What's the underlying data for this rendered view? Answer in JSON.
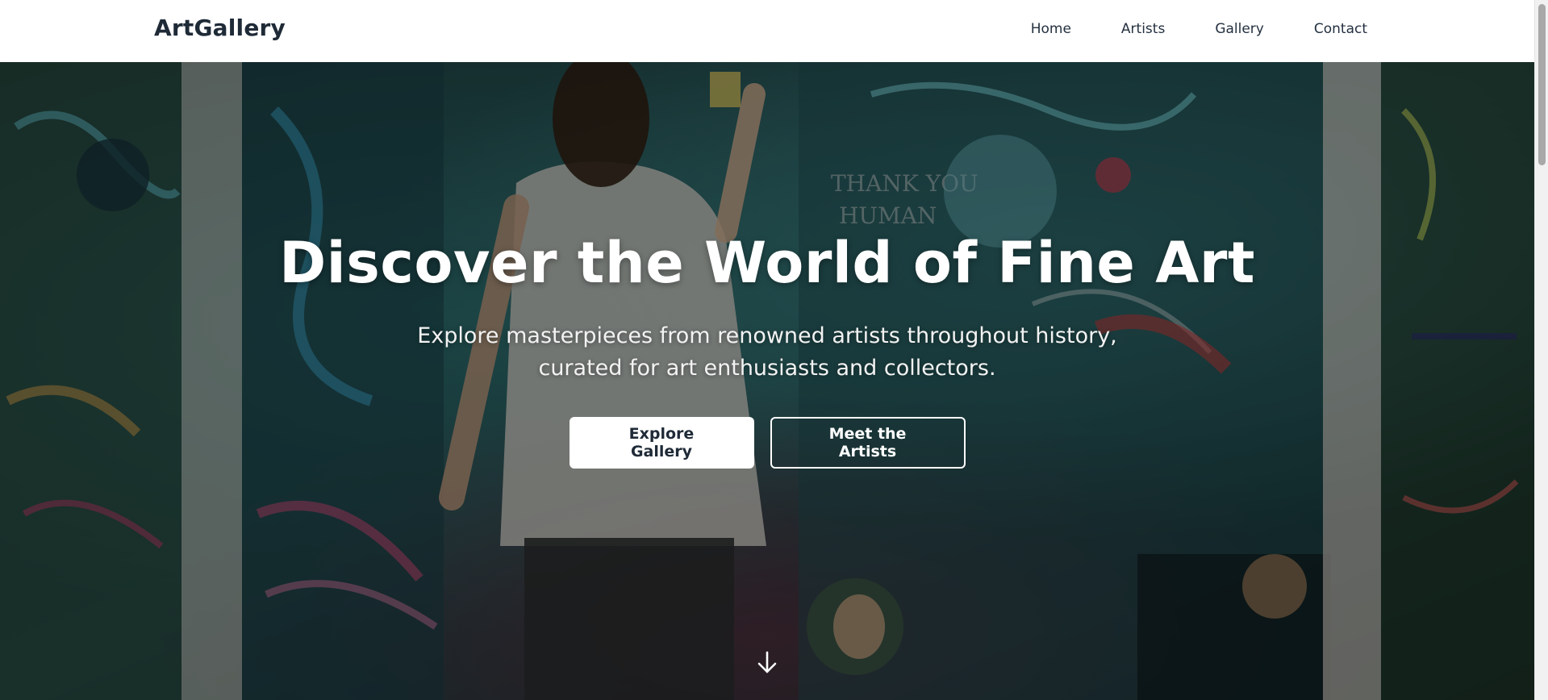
{
  "nav": {
    "brand": "ArtGallery",
    "links": [
      {
        "label": "Home"
      },
      {
        "label": "Artists"
      },
      {
        "label": "Gallery"
      },
      {
        "label": "Contact"
      }
    ]
  },
  "hero": {
    "title": "Discover the World of Fine Art",
    "subtitle_line1": "Explore masterpieces from renowned artists throughout history,",
    "subtitle_line2": "curated for art enthusiasts and collectors.",
    "primary_button": "Explore Gallery",
    "secondary_button": "Meet the Artists",
    "scroll_icon": "arrow-down-icon"
  },
  "colors": {
    "text_dark": "#1f2a37",
    "hero_text": "#ffffff",
    "overlay": "rgba(0,0,0,0.35)"
  }
}
